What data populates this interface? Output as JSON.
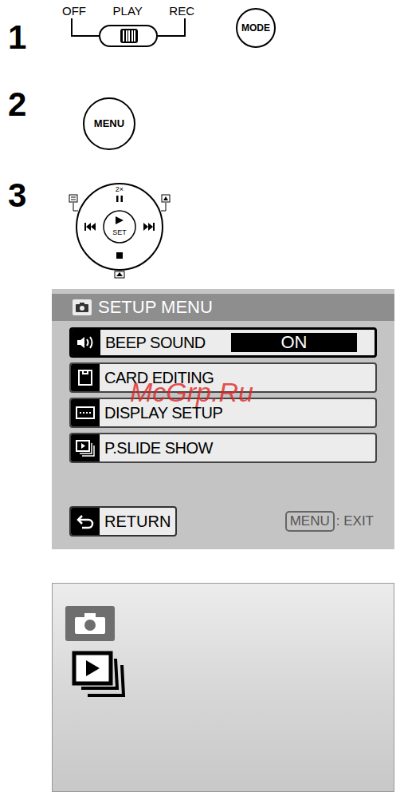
{
  "step1": {
    "number": "1",
    "switch": [
      {
        "label": "OFF",
        "selected": false
      },
      {
        "label": "PLAY",
        "selected": true
      },
      {
        "label": "REC",
        "selected": false
      }
    ],
    "mode_button": "MODE"
  },
  "step2": {
    "number": "2",
    "menu_button": "MENU"
  },
  "step3": {
    "number": "3",
    "dial": {
      "top_label": "2×",
      "center_label": "SET"
    }
  },
  "setup_menu": {
    "title": "SETUP MENU",
    "items": [
      {
        "label": "BEEP SOUND",
        "value": "ON",
        "selected": true
      },
      {
        "label": "CARD EDITING",
        "selected": false
      },
      {
        "label": "DISPLAY SETUP",
        "selected": false
      },
      {
        "label": "P.SLIDE SHOW",
        "selected": false
      }
    ],
    "return_button": "RETURN",
    "exit_key": "MENU",
    "exit_label": ": EXIT"
  },
  "watermark": "McGrp.Ru"
}
